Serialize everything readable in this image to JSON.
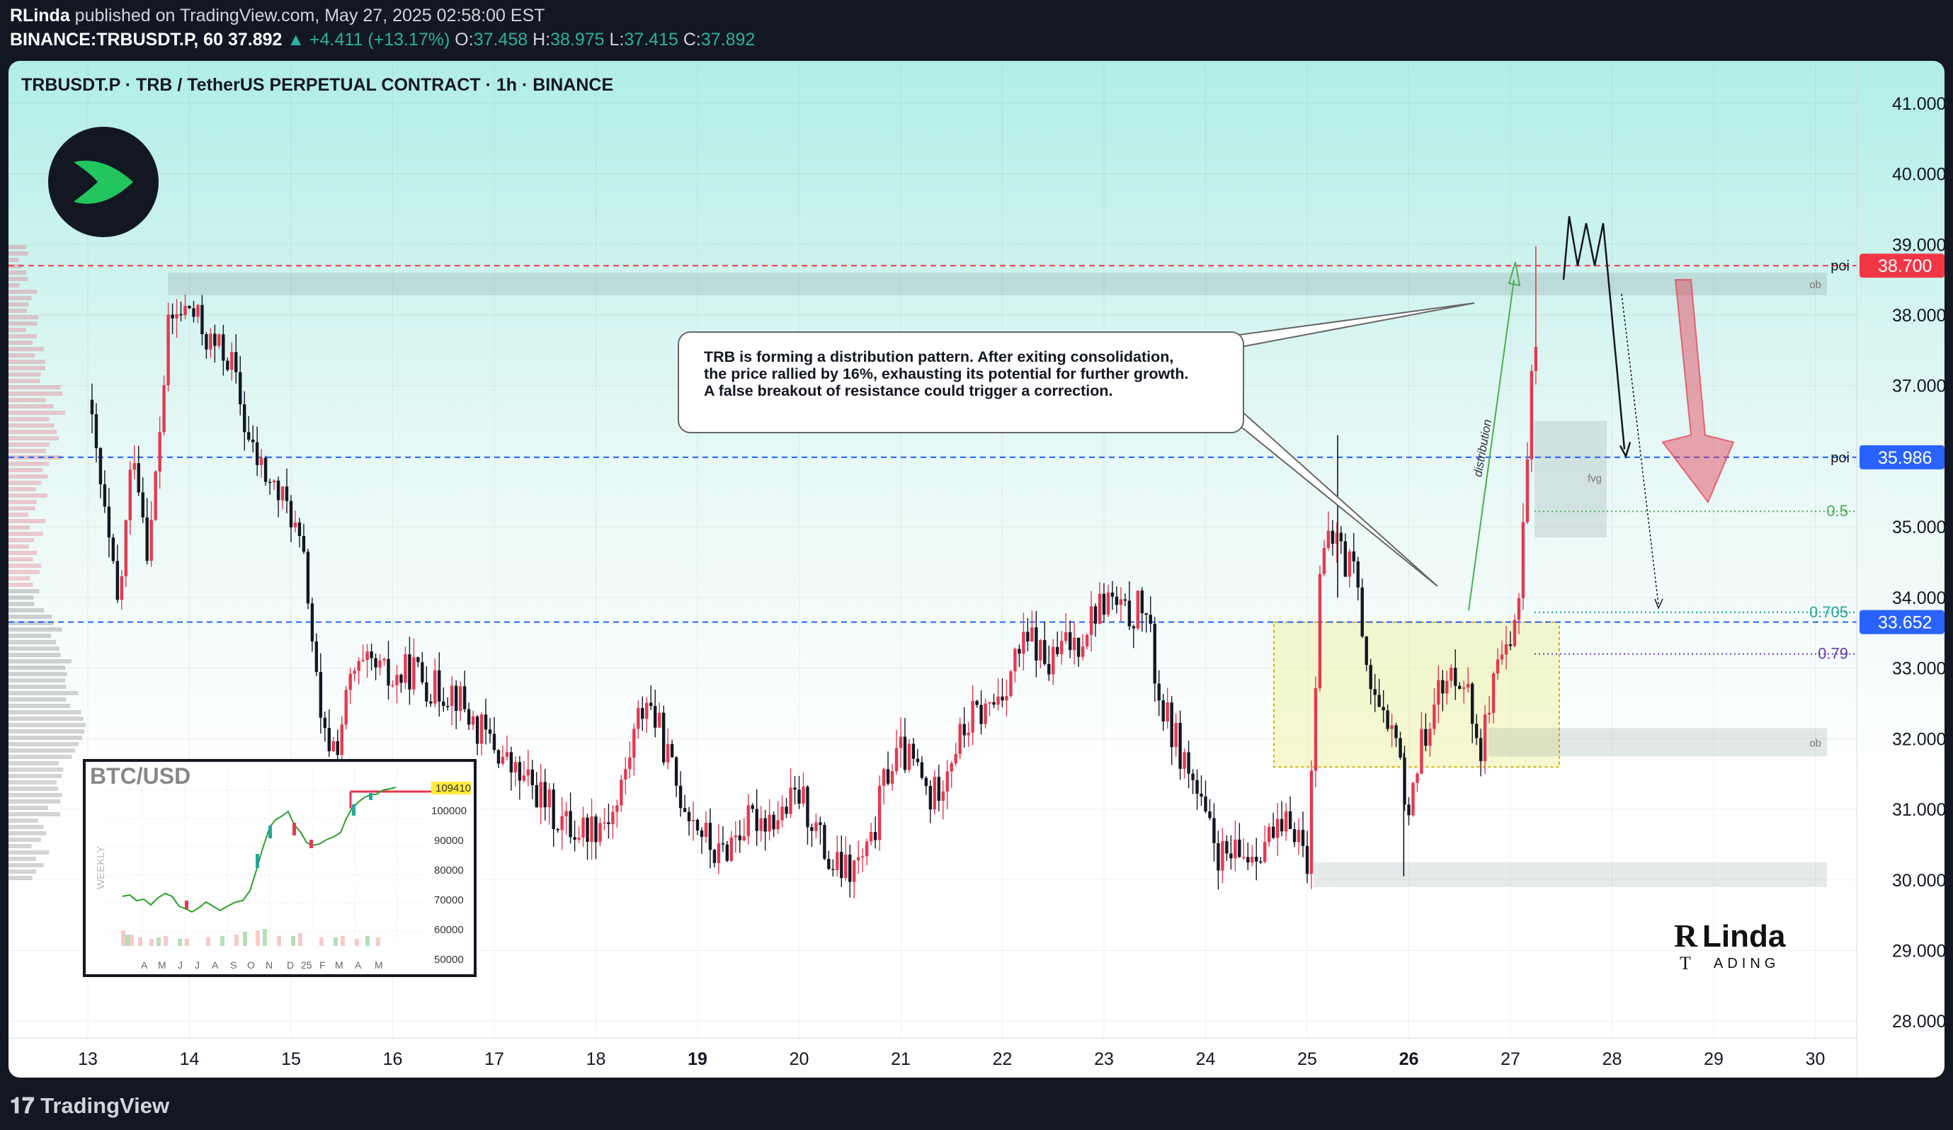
{
  "header": {
    "author": "RLinda",
    "published_text": "published on TradingView.com, May 27, 2025 02:58:00 EST",
    "symbol": "BINANCE:TRBUSDT.P, 60",
    "last": "37.892",
    "change": "▲ +4.411 (+13.17%)",
    "o_label": "O:",
    "o": "37.458",
    "h_label": "H:",
    "h": "38.975",
    "l_label": "L:",
    "l": "37.415",
    "c_label": "C:",
    "c": "37.892"
  },
  "symbol_line": "TRBUSDT.P · TRB / TetherUS PERPETUAL CONTRACT · 1h · BINANCE",
  "callout": {
    "line1": "TRB is forming a distribution pattern. After exiting consolidation,",
    "line2": "the price rallied by 16%, exhausting its potential for further growth.",
    "line3": "A false breakout of resistance could trigger a correction."
  },
  "footer": {
    "brand": "TradingView"
  },
  "watermark": {
    "name": "Linda",
    "sub": "ADING",
    "letters": [
      "R",
      "T"
    ]
  },
  "colors": {
    "up": "#e53950",
    "down": "#131722",
    "price_red": "#f23645",
    "price_blue": "#2962ff",
    "fib_green": "#4caf50",
    "fib_teal": "#26a69a",
    "fib_purple": "#673ab7",
    "panel_top": "#b1ede7"
  },
  "annotations": {
    "poi_upper": "poi",
    "poi_lower": "poi",
    "fib_05": "0.5",
    "fib_0705": "0.705",
    "fib_079": "0.79",
    "ob_upper": "ob",
    "ob_lower": "ob",
    "fvg": "fvg",
    "distribution": "distribution"
  },
  "price_tags": {
    "red": "38.700",
    "blue1": "35.986",
    "blue2": "33.652"
  },
  "chart_data": {
    "type": "candlestick",
    "y_axis": {
      "ticks": [
        "41.000",
        "40.000",
        "39.000",
        "38.000",
        "37.000",
        "36.000",
        "35.000",
        "34.000",
        "33.000",
        "32.000",
        "31.000",
        "30.000",
        "29.000",
        "28.000"
      ],
      "min": 27.2,
      "max": 41.6,
      "side": "right"
    },
    "x_axis": {
      "ticks": [
        "13",
        "14",
        "15",
        "16",
        "17",
        "18",
        "19",
        "20",
        "21",
        "22",
        "23",
        "24",
        "25",
        "26",
        "27",
        "28",
        "29",
        "30"
      ],
      "bold": [
        "19",
        "26"
      ]
    },
    "grid": true,
    "levels": [
      {
        "price": 38.7,
        "style": "dashed",
        "color": "#f23645",
        "label": "poi"
      },
      {
        "price": 35.986,
        "style": "dashed",
        "color": "#2962ff",
        "label": "poi"
      },
      {
        "price": 33.652,
        "style": "dashed",
        "color": "#2962ff"
      },
      {
        "price": 35.22,
        "style": "dotted",
        "color": "#4caf50",
        "label": "0.5"
      },
      {
        "price": 33.79,
        "style": "dotted",
        "color": "#26a69a",
        "label": "0.705"
      },
      {
        "price": 33.2,
        "style": "dotted",
        "color": "#673ab7",
        "label": "0.79"
      }
    ],
    "zones": [
      {
        "name": "ob",
        "from": 38.28,
        "to": 38.6
      },
      {
        "name": "fvg",
        "from": 34.85,
        "to": 36.5
      },
      {
        "name": "consolidation",
        "from": 31.6,
        "to": 33.65
      },
      {
        "name": "ob",
        "from": 31.75,
        "to": 32.15
      },
      {
        "name": "support",
        "from": 29.9,
        "to": 30.25
      }
    ],
    "ohlc_last": {
      "open": 37.458,
      "high": 38.975,
      "low": 37.415,
      "close": 37.892
    },
    "path": [
      [
        13.0,
        36.8
      ],
      [
        13.2,
        34.8
      ],
      [
        13.3,
        33.8
      ],
      [
        13.45,
        36.2
      ],
      [
        13.6,
        34.6
      ],
      [
        13.8,
        37.9
      ],
      [
        14.0,
        38.1
      ],
      [
        14.2,
        37.6
      ],
      [
        14.4,
        37.4
      ],
      [
        14.6,
        36.1
      ],
      [
        14.8,
        35.6
      ],
      [
        15.0,
        35.2
      ],
      [
        15.15,
        34.3
      ],
      [
        15.3,
        32.0
      ],
      [
        15.45,
        31.9
      ],
      [
        15.6,
        32.9
      ],
      [
        15.8,
        33.0
      ],
      [
        16.0,
        32.8
      ],
      [
        16.2,
        33.0
      ],
      [
        16.4,
        32.7
      ],
      [
        16.6,
        32.7
      ],
      [
        16.8,
        32.2
      ],
      [
        17.0,
        31.9
      ],
      [
        17.2,
        31.5
      ],
      [
        17.4,
        31.3
      ],
      [
        17.6,
        30.9
      ],
      [
        17.8,
        30.7
      ],
      [
        18.0,
        30.8
      ],
      [
        18.2,
        31.0
      ],
      [
        18.4,
        32.2
      ],
      [
        18.5,
        32.6
      ],
      [
        18.65,
        32.0
      ],
      [
        18.8,
        31.3
      ],
      [
        19.0,
        30.8
      ],
      [
        19.2,
        30.3
      ],
      [
        19.4,
        30.7
      ],
      [
        19.6,
        30.9
      ],
      [
        19.8,
        30.9
      ],
      [
        20.0,
        31.2
      ],
      [
        20.15,
        30.8
      ],
      [
        20.3,
        30.2
      ],
      [
        20.5,
        30.1
      ],
      [
        20.7,
        30.4
      ],
      [
        20.85,
        31.5
      ],
      [
        21.0,
        31.8
      ],
      [
        21.15,
        31.6
      ],
      [
        21.3,
        31.1
      ],
      [
        21.5,
        31.8
      ],
      [
        21.7,
        32.3
      ],
      [
        21.85,
        32.4
      ],
      [
        22.0,
        32.7
      ],
      [
        22.15,
        33.2
      ],
      [
        22.3,
        33.4
      ],
      [
        22.45,
        33.0
      ],
      [
        22.6,
        33.3
      ],
      [
        22.75,
        33.4
      ],
      [
        22.9,
        33.8
      ],
      [
        23.05,
        34.0
      ],
      [
        23.2,
        33.7
      ],
      [
        23.4,
        33.9
      ],
      [
        23.55,
        32.5
      ],
      [
        23.7,
        32.0
      ],
      [
        23.85,
        31.5
      ],
      [
        24.0,
        30.8
      ],
      [
        24.15,
        30.3
      ],
      [
        24.3,
        30.3
      ],
      [
        24.45,
        30.4
      ],
      [
        24.6,
        30.6
      ],
      [
        24.75,
        30.6
      ],
      [
        24.85,
        30.9
      ],
      [
        25.0,
        30.3
      ],
      [
        25.05,
        31.6
      ],
      [
        25.12,
        34.5
      ],
      [
        25.22,
        34.7
      ],
      [
        25.3,
        34.9
      ],
      [
        25.38,
        34.4
      ],
      [
        25.45,
        34.7
      ],
      [
        25.5,
        34.0
      ],
      [
        25.6,
        33.0
      ],
      [
        25.68,
        32.5
      ],
      [
        25.8,
        31.9
      ],
      [
        25.9,
        32.3
      ],
      [
        25.95,
        30.8
      ],
      [
        26.05,
        31.5
      ],
      [
        26.15,
        32.0
      ],
      [
        26.25,
        32.7
      ],
      [
        26.35,
        32.6
      ],
      [
        26.45,
        33.0
      ],
      [
        26.55,
        32.9
      ],
      [
        26.62,
        32.3
      ],
      [
        26.72,
        31.9
      ],
      [
        26.82,
        32.6
      ],
      [
        26.9,
        33.0
      ],
      [
        27.0,
        33.2
      ],
      [
        27.05,
        33.7
      ],
      [
        27.1,
        34.5
      ],
      [
        27.15,
        35.7
      ],
      [
        27.2,
        37.0
      ],
      [
        27.25,
        37.6
      ],
      [
        27.3,
        37.9
      ]
    ]
  }
}
